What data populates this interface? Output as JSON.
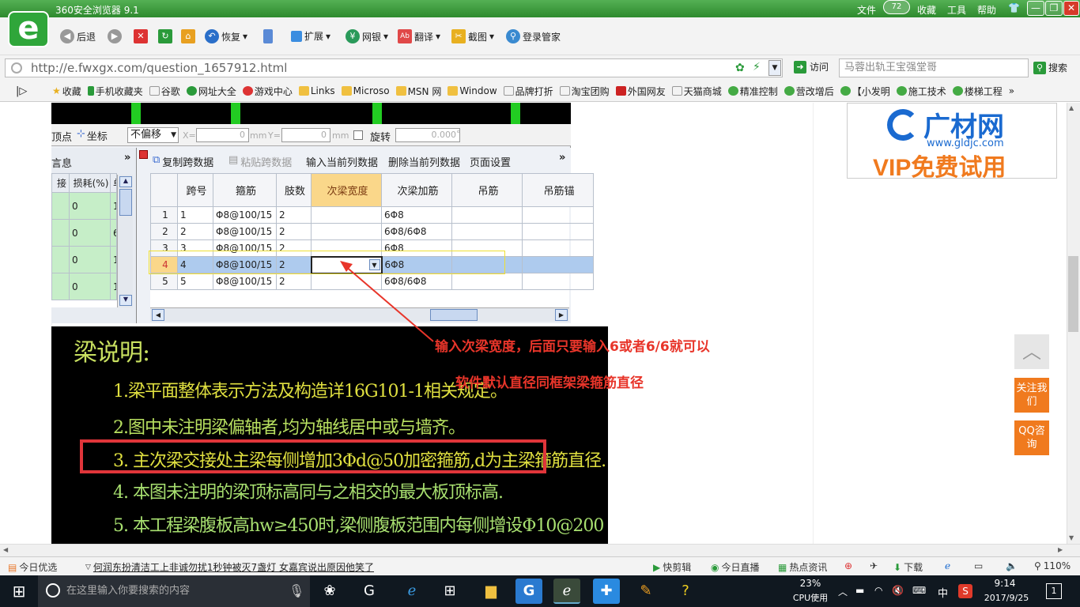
{
  "browser": {
    "title": "360安全浏览器 9.1",
    "menu": [
      "文件",
      "收藏",
      "工具",
      "帮助"
    ],
    "badge": "72",
    "window_buttons": [
      "—",
      "❐",
      "✕"
    ],
    "toolbar": {
      "back": "后退",
      "restore": "恢复",
      "extend": "扩展",
      "netbank": "网银",
      "translate": "翻译",
      "screenshot": "截图",
      "login": "登录管家"
    },
    "address": "http://e.fwxgx.com/question_1657912.html",
    "visit": "访问",
    "search_placeholder": "马蓉出轨王宝强堂哥",
    "search_button": "搜索",
    "bookmarks": [
      "收藏",
      "手机收藏夹",
      "谷歌",
      "网址大全",
      "游戏中心",
      "Links",
      "Microso",
      "MSN 网",
      "Window",
      "品牌打折",
      "淘宝团购",
      "外国网友",
      "天猫商城",
      "精准控制",
      "营改增后",
      "【小发明",
      "施工技术",
      "楼梯工程"
    ],
    "bookmarks_more": "»"
  },
  "software": {
    "toolbar": {
      "vertex": "顶点",
      "coord": "坐标",
      "offset_select": "不偏移",
      "x_label": "X=",
      "x_value": "0",
      "unit_mm": "mm",
      "y_label": "Y=",
      "y_value": "0",
      "rotate": "旋转",
      "rotate_value": "0.000",
      "deg": "°"
    },
    "left_panel": {
      "title": "言息",
      "headers": [
        "接",
        "损耗(%)",
        "单"
      ],
      "rows": [
        [
          "0",
          "12"
        ],
        [
          "0",
          "6."
        ],
        [
          "0",
          "16"
        ],
        [
          "0",
          "12"
        ]
      ]
    },
    "actions": [
      "复制跨数据",
      "粘贴跨数据",
      "输入当前列数据",
      "删除当前列数据",
      "页面设置"
    ],
    "more": "»",
    "grid": {
      "headers": [
        "",
        "跨号",
        "箍筋",
        "肢数",
        "次梁宽度",
        "次梁加筋",
        "吊筋",
        "吊筋锚"
      ],
      "rows": [
        [
          "1",
          "1",
          "Φ8@100/15",
          "2",
          "",
          "6Φ8",
          "",
          ""
        ],
        [
          "2",
          "2",
          "Φ8@100/15",
          "2",
          "",
          "6Φ8/6Φ8",
          "",
          ""
        ],
        [
          "3",
          "3",
          "Φ8@100/15",
          "2",
          "",
          "6Φ8",
          "",
          ""
        ],
        [
          "4",
          "4",
          "Φ8@100/15",
          "2",
          "",
          "6Φ8",
          "",
          ""
        ],
        [
          "5",
          "5",
          "Φ8@100/15",
          "2",
          "",
          "6Φ8/6Φ8",
          "",
          ""
        ]
      ],
      "selected_row": 3
    }
  },
  "cad": {
    "heading": "梁说明:",
    "lines": [
      "1.梁平面整体表示方法及构造详16G101-1相关规定。",
      "2.图中未注明梁偏轴者,均为轴线居中或与墙齐。",
      "3. 主次梁交接处主梁每侧增加3Φd@50加密箍筋,d为主梁箍筋直径.",
      "4. 本图未注明的梁顶标高同与之相交的最大板顶标高.",
      "5. 本工程梁腹板高hw≥450时,梁侧腹板范围内每侧增设Φ10@200"
    ]
  },
  "annotations": {
    "line1": "输入次梁宽度，后面只要输入6或者6/6就可以",
    "line2": "软件默认直径同框架梁箍筋直径"
  },
  "ad": {
    "brand": "广材网",
    "site": "www.gldjc.com",
    "vip": "VIP免费试用"
  },
  "side": {
    "follow": "关注我们",
    "qq": "QQ咨询"
  },
  "statusbar": {
    "today": "今日优选",
    "news": "何润东扮清洁工上非诚勿扰1秒钟被灭7盏灯 女嘉宾说出原因他笑了",
    "quickclip": "快剪辑",
    "live": "今日直播",
    "hot": "热点资讯",
    "download": "下载",
    "zoom": "110%"
  },
  "taskbar": {
    "search_placeholder": "在这里输入你要搜索的内容",
    "cpu_percent": "23%",
    "cpu_label": "CPU使用",
    "ime": "中",
    "time": "9:14",
    "date": "2017/9/25",
    "notifications": "1"
  },
  "colors": {
    "browser_green": "#2e8a2e",
    "annotation_red": "#e8352a",
    "cad_yellow": "#d8d84a",
    "side_orange": "#f07a1e"
  }
}
